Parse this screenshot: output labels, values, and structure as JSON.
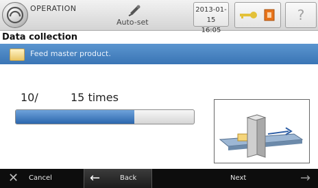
{
  "header": {
    "mode_label": "OPERATION",
    "autoset_label": "Auto-set",
    "date": "2013-01-15",
    "time": "16:05",
    "help_glyph": "?"
  },
  "page": {
    "title": "Data collection"
  },
  "instruction": {
    "text": "Feed master product."
  },
  "counter": {
    "current": "10/",
    "total": "15 times"
  },
  "progress": {
    "value": 10,
    "max": 15,
    "fill_color": "#2b66ad"
  },
  "footer": {
    "cancel_label": "Cancel",
    "back_label": "Back",
    "next_label": "Next"
  },
  "colors": {
    "banner": "#3a75b5",
    "status_orange": "#e8731a",
    "key_yellow": "#e3c13a"
  },
  "icons": {
    "home": "home-icon",
    "autoset": "autoset-icon",
    "key": "key-icon",
    "status": "status-icon",
    "help": "help-icon",
    "product": "product-icon",
    "cancel": "close-icon",
    "back": "arrow-left-icon",
    "next": "arrow-right-icon"
  }
}
